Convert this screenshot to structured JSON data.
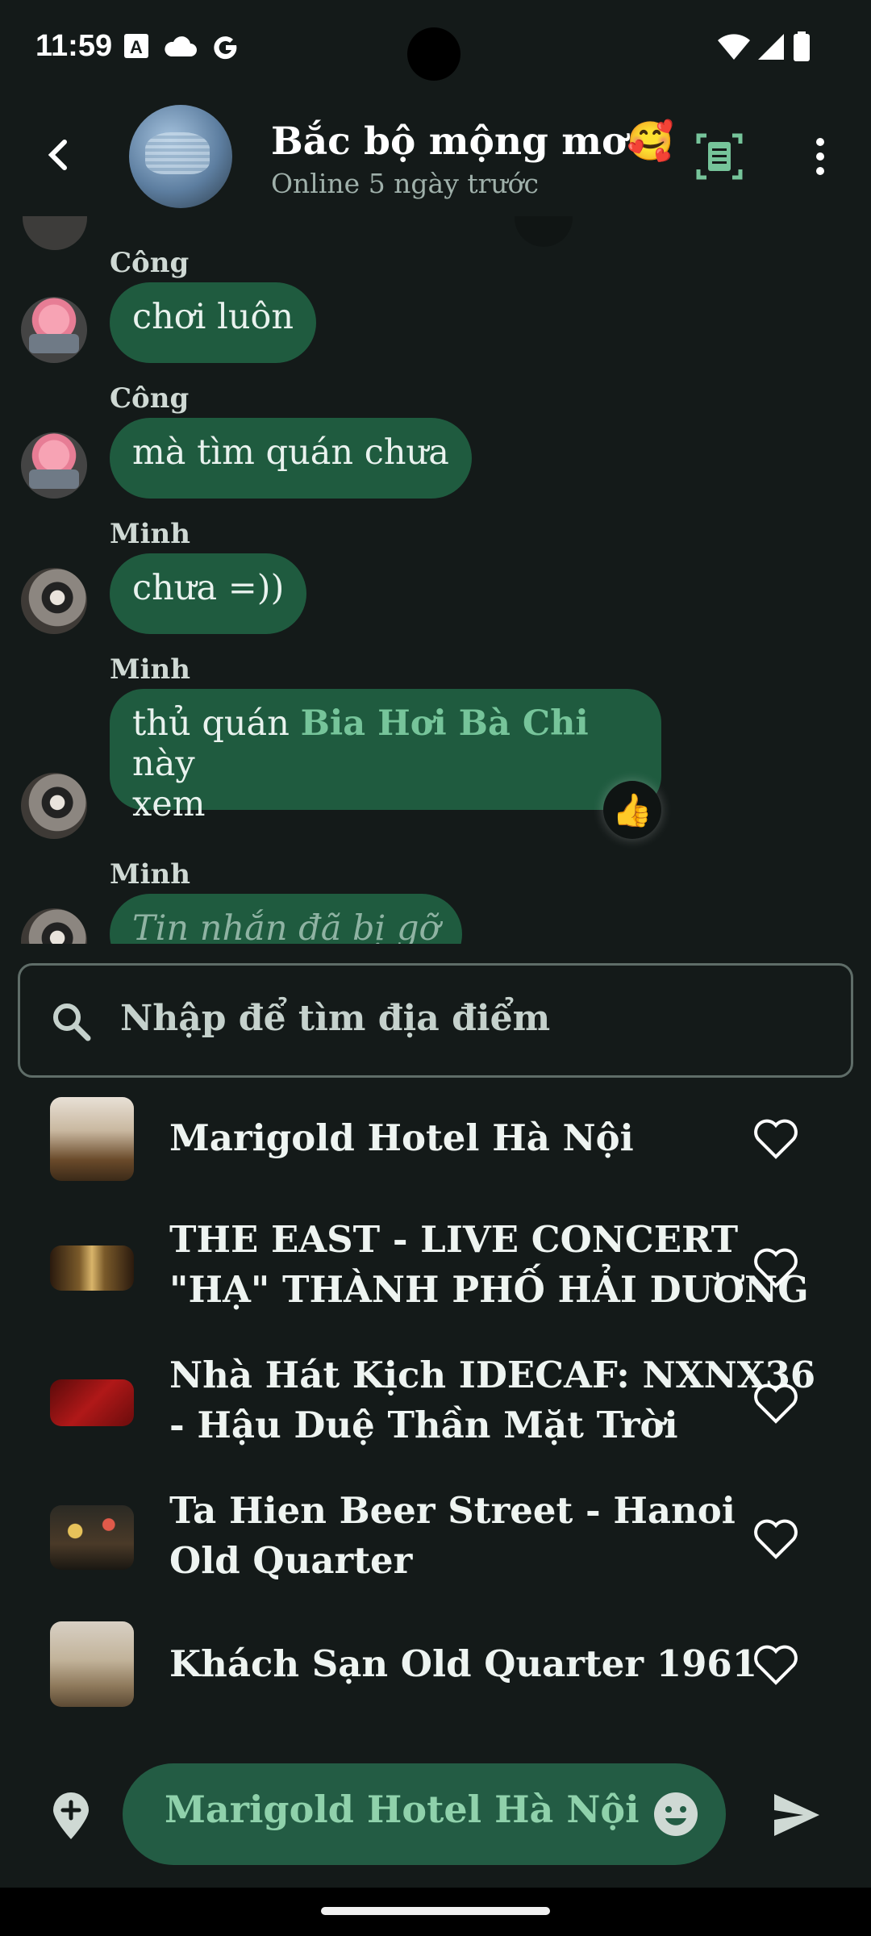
{
  "status_bar": {
    "time": "11:59",
    "icons": [
      "a-badge-icon",
      "cloud-icon",
      "google-g-icon",
      "wifi-icon",
      "signal-icon",
      "battery-icon"
    ]
  },
  "header": {
    "back_icon": "arrow-back-icon",
    "title": "Bắc bộ mộng mơ🥰",
    "subtitle": "Online 5 ngày trước",
    "actions": [
      "list-document-icon",
      "more-vert-icon"
    ]
  },
  "messages": [
    {
      "sender": "Công",
      "text": "chơi luôn"
    },
    {
      "sender": "Công",
      "text": "mà tìm quán chưa"
    },
    {
      "sender": "Minh",
      "text": "chưa =))"
    },
    {
      "sender": "Minh",
      "text_before": "thủ quán ",
      "link": "Bia Hơi Bà Chi",
      "text_after": " này",
      "text_line2": "xem",
      "reaction": "👍"
    },
    {
      "sender": "Minh",
      "text": "Tin nhắn đã bị gỡ"
    }
  ],
  "search": {
    "icon": "search-icon",
    "placeholder": "Nhập để tìm địa điểm"
  },
  "places": [
    {
      "name": "Marigold Hotel Hà Nội",
      "lines": [
        "Marigold Hotel Hà Nội"
      ]
    },
    {
      "name": "THE EAST - LIVE CONCERT \"HẠ\" THÀNH PHỐ HẢI DƯƠNG",
      "lines": [
        "THE EAST - LIVE CONCERT",
        "\"HẠ\" THÀNH PHỐ HẢI DƯƠNG"
      ]
    },
    {
      "name": "Nhà Hát Kịch IDECAF: NXNX36 - Hậu Duệ Thần Mặt Trời",
      "lines": [
        "Nhà Hát Kịch IDECAF: NXNX36",
        "- Hậu Duệ Thần Mặt Trời"
      ]
    },
    {
      "name": "Ta Hien Beer Street - Hanoi Old Quarter",
      "lines": [
        "Ta Hien Beer Street - Hanoi",
        "Old Quarter"
      ]
    },
    {
      "name": "Khách Sạn Old Quarter 1961",
      "lines": [
        "Khách Sạn Old Quarter 1961"
      ]
    }
  ],
  "composer": {
    "value": "Marigold Hotel Hà Nội",
    "left_icon": "add-location-icon",
    "emoji_icon": "emoji-icon",
    "send_icon": "send-icon"
  },
  "colors": {
    "background": "#141a19",
    "bubble": "#1f5b3f",
    "accent": "#76c49a"
  }
}
